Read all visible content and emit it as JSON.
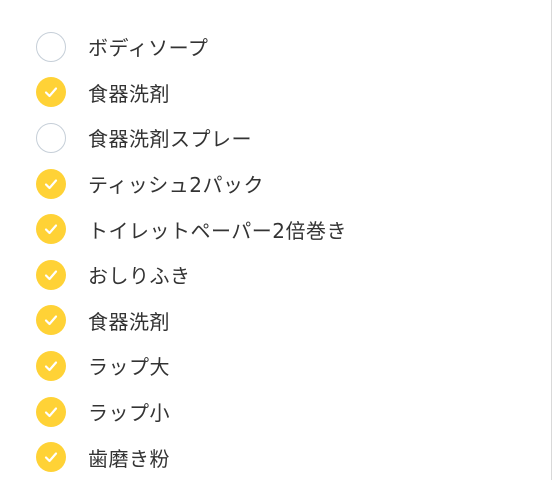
{
  "colors": {
    "checked_fill": "#ffd236",
    "unchecked_border": "#c6cfd8",
    "label_text": "#333333"
  },
  "icons": {
    "checked": "check-icon",
    "unchecked": "empty-circle-icon"
  },
  "items": [
    {
      "label": "ボディソープ",
      "checked": false
    },
    {
      "label": "食器洗剤",
      "checked": true
    },
    {
      "label": "食器洗剤スプレー",
      "checked": false
    },
    {
      "label": "ティッシュ2パック",
      "checked": true
    },
    {
      "label": "トイレットペーパー2倍巻き",
      "checked": true
    },
    {
      "label": "おしりふき",
      "checked": true
    },
    {
      "label": "食器洗剤",
      "checked": true
    },
    {
      "label": "ラップ大",
      "checked": true
    },
    {
      "label": "ラップ小",
      "checked": true
    },
    {
      "label": "歯磨き粉",
      "checked": true
    }
  ]
}
